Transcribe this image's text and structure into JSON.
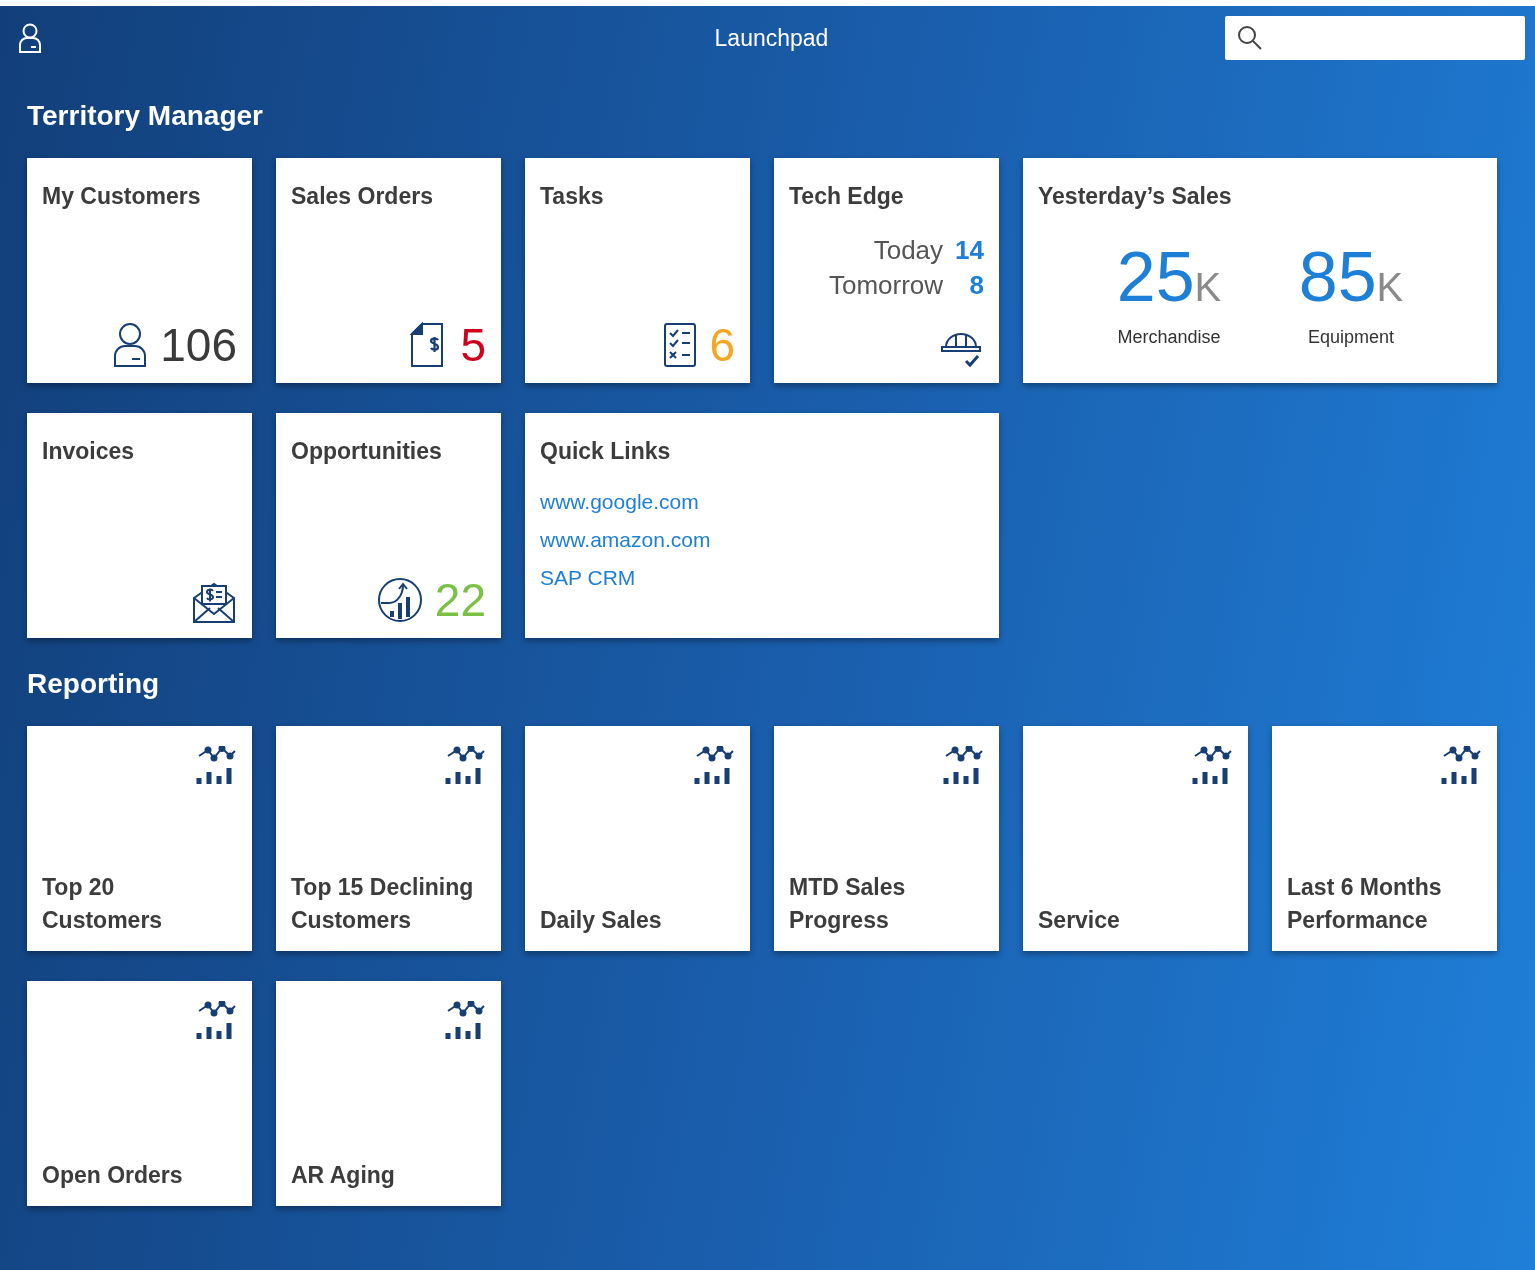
{
  "header": {
    "title": "Launchpad"
  },
  "sections": [
    {
      "title": "Territory Manager",
      "tiles": [
        {
          "kind": "count",
          "title": "My Customers",
          "value": "106",
          "color": "#3a3a3a"
        },
        {
          "kind": "count",
          "title": "Sales Orders",
          "value": "5",
          "color": "#d0021b"
        },
        {
          "kind": "count",
          "title": "Tasks",
          "value": "6",
          "color": "#f5a623"
        },
        {
          "kind": "schedule",
          "title": "Tech Edge",
          "rows": [
            {
              "label": "Today",
              "value": "14"
            },
            {
              "label": "Tomorrow",
              "value": "8"
            }
          ]
        },
        {
          "kind": "figures",
          "title": "Yesterday’s Sales",
          "figures": [
            {
              "value": "25",
              "unit": "K",
              "label": "Merchandise"
            },
            {
              "value": "85",
              "unit": "K",
              "label": "Equipment"
            }
          ]
        },
        {
          "kind": "count",
          "title": "Invoices"
        },
        {
          "kind": "count",
          "title": "Opportunities",
          "value": "22",
          "color": "#7ac143"
        },
        {
          "kind": "links",
          "title": "Quick Links",
          "links": [
            "www.google.com",
            "www.amazon.com",
            "SAP CRM"
          ]
        }
      ]
    },
    {
      "title": "Reporting",
      "tiles": [
        {
          "kind": "report",
          "title": "Top 20 Customers"
        },
        {
          "kind": "report",
          "title": "Top 15 Declining Customers"
        },
        {
          "kind": "report",
          "title": "Daily Sales"
        },
        {
          "kind": "report",
          "title": "MTD Sales Progress"
        },
        {
          "kind": "report",
          "title": "Service"
        },
        {
          "kind": "report",
          "title": "Last 6 Months Performance"
        },
        {
          "kind": "report",
          "title": "Open Orders"
        },
        {
          "kind": "report",
          "title": "AR Aging"
        }
      ]
    }
  ]
}
